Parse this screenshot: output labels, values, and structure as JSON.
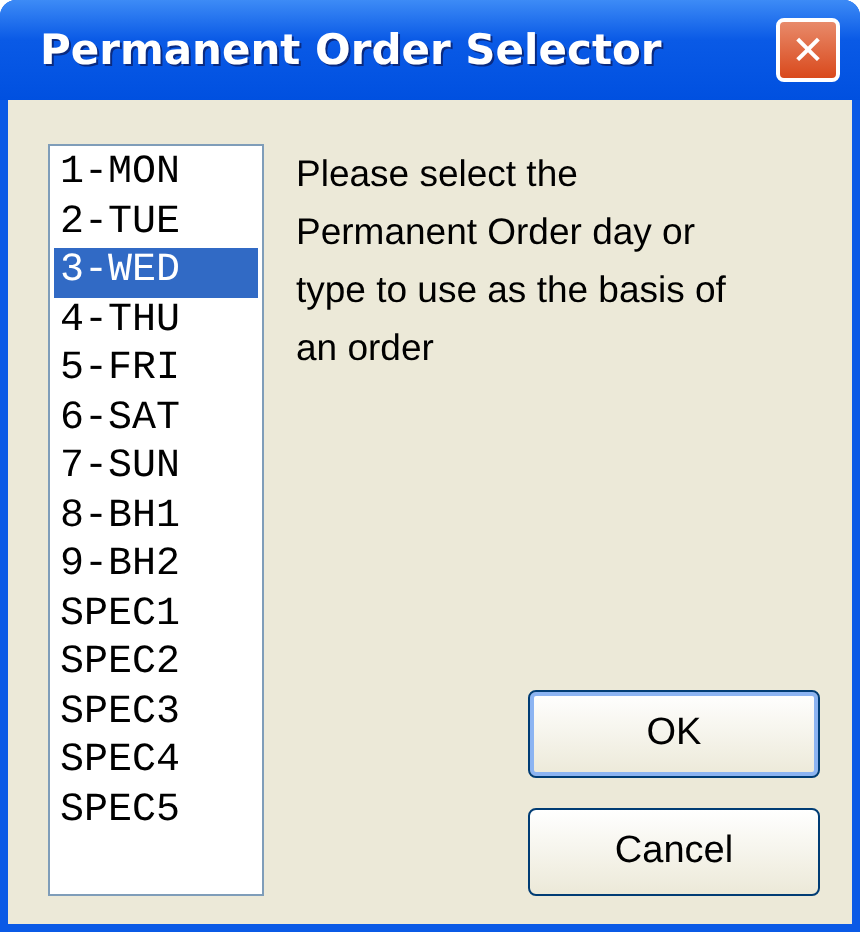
{
  "window": {
    "title": "Permanent Order Selector",
    "close": "✕"
  },
  "list": [
    {
      "label": "1-MON",
      "selected": false
    },
    {
      "label": "2-TUE",
      "selected": false
    },
    {
      "label": "3-WED",
      "selected": true
    },
    {
      "label": "4-THU",
      "selected": false
    },
    {
      "label": "5-FRI",
      "selected": false
    },
    {
      "label": "6-SAT",
      "selected": false
    },
    {
      "label": "7-SUN",
      "selected": false
    },
    {
      "label": "8-BH1",
      "selected": false
    },
    {
      "label": "9-BH2",
      "selected": false
    },
    {
      "label": "SPEC1",
      "selected": false
    },
    {
      "label": "SPEC2",
      "selected": false
    },
    {
      "label": "SPEC3",
      "selected": false
    },
    {
      "label": "SPEC4",
      "selected": false
    },
    {
      "label": "SPEC5",
      "selected": false
    }
  ],
  "message": "Please select the Permanent Order day or type to use as the basis of an order",
  "buttons": [
    {
      "label": "OK",
      "default": true
    },
    {
      "label": "Cancel",
      "default": false
    }
  ]
}
